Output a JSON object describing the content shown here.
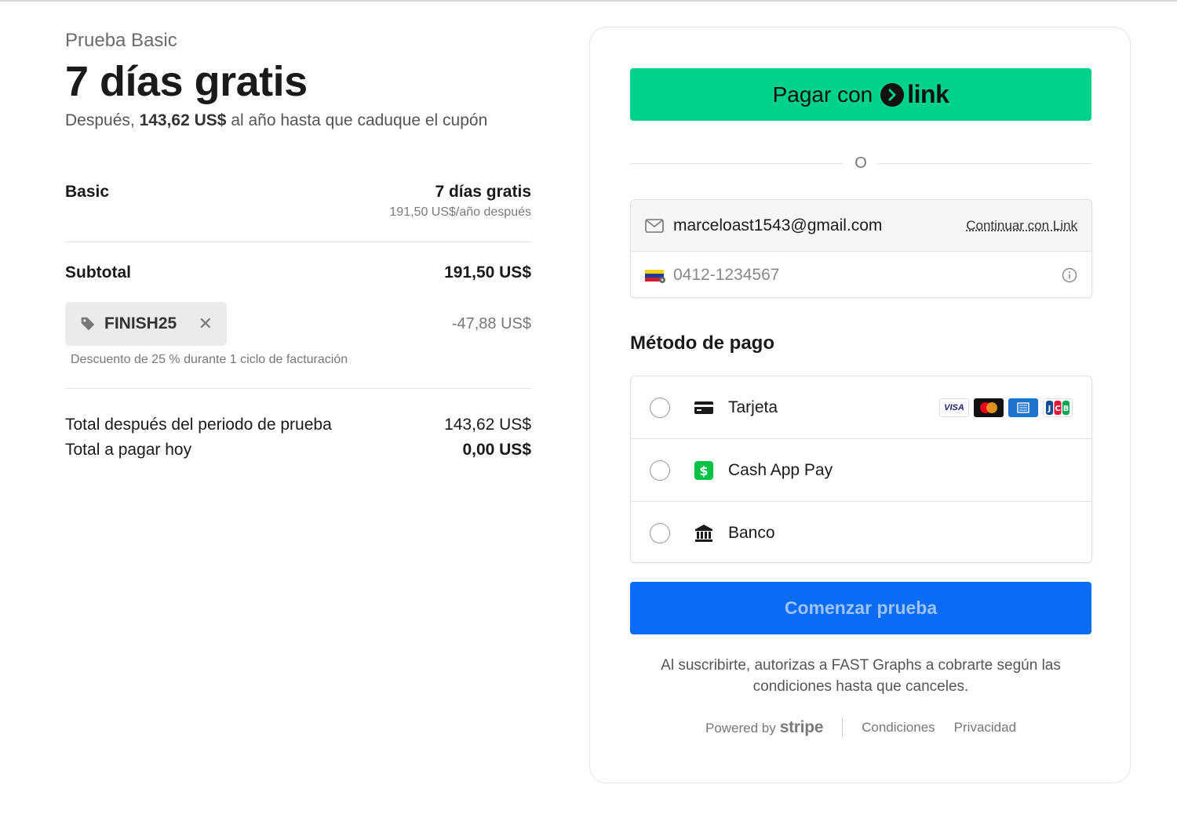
{
  "summary": {
    "plan_name": "Prueba Basic",
    "trial_title": "7 días gratis",
    "after_prefix": "Después, ",
    "after_amount": "143,62 US$",
    "after_suffix": " al año hasta que caduque el cupón",
    "line_item": {
      "name": "Basic",
      "price": "7 días gratis",
      "sub": "191,50 US$/año después"
    },
    "subtotal_label": "Subtotal",
    "subtotal_value": "191,50 US$",
    "coupon_code": "FINISH25",
    "coupon_remove": "✕",
    "discount_value": "-47,88 US$",
    "discount_desc": "Descuento de 25 % durante 1 ciclo de facturación",
    "total_after_label": "Total después del periodo de prueba",
    "total_after_value": "143,62 US$",
    "total_today_label": "Total a pagar hoy",
    "total_today_value": "0,00 US$"
  },
  "checkout": {
    "link_button_label": "Pagar con",
    "link_logo_text": "link",
    "or_text": "O",
    "email": "marceloast1543@gmail.com",
    "continue_link": "Continuar con Link",
    "phone": "0412-1234567",
    "method_title": "Método de pago",
    "methods": [
      {
        "label": "Tarjeta",
        "icon": "credit-card-icon"
      },
      {
        "label": "Cash App Pay",
        "icon": "cash-app-icon"
      },
      {
        "label": "Banco",
        "icon": "bank-icon"
      }
    ],
    "brands": [
      "VISA",
      "Mastercard",
      "AMEX",
      "JCB"
    ],
    "start_button": "Comenzar prueba",
    "terms": "Al suscribirte, autorizas a FAST Graphs a cobrarte según las condiciones hasta que canceles.",
    "footer": {
      "powered_by": "Powered by",
      "stripe": "stripe",
      "conditions": "Condiciones",
      "privacy": "Privacidad"
    }
  },
  "colors": {
    "link_green": "#00d28c",
    "primary_blue": "#0a6cf5",
    "cash_app_green": "#00c244"
  }
}
